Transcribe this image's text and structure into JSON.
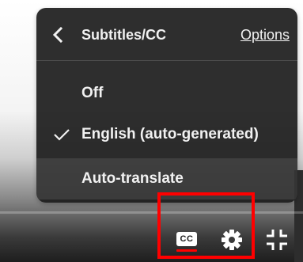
{
  "menu": {
    "title": "Subtitles/CC",
    "options_label": "Options",
    "items": [
      {
        "label": "Off",
        "selected": false,
        "highlighted": false
      },
      {
        "label": "English (auto-generated)",
        "selected": true,
        "highlighted": false
      },
      {
        "label": "Auto-translate",
        "selected": false,
        "highlighted": true
      }
    ],
    "icons": {
      "back": "chevron-left-icon",
      "check": "checkmark-icon"
    }
  },
  "controls": {
    "cc_label": "CC",
    "subtitles_active": true,
    "icons": {
      "subtitles": "closed-captions-icon",
      "settings": "gear-icon",
      "fullscreen": "exit-fullscreen-icon"
    }
  },
  "colors": {
    "accent": "#ff0000",
    "menu_bg": "#1c1c1c",
    "menu_text": "#f1f1f1"
  }
}
